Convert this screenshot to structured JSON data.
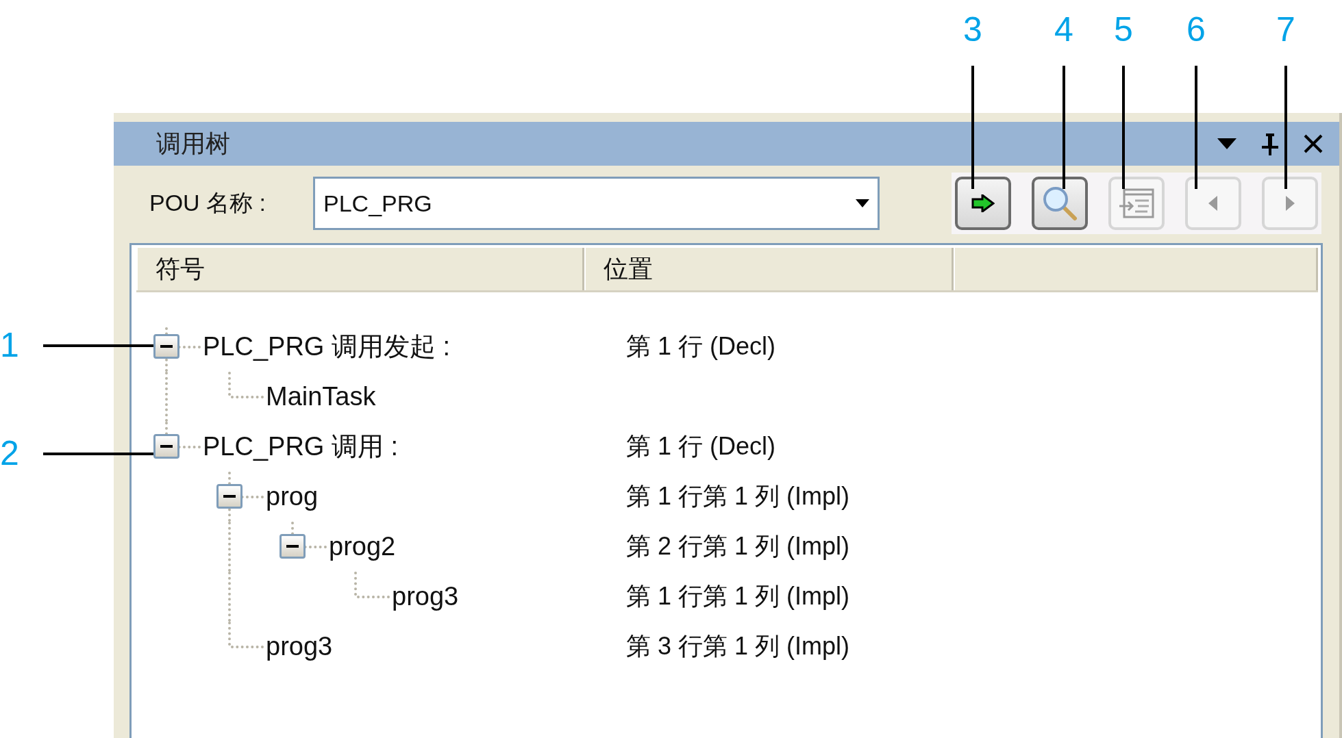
{
  "window": {
    "title": "调用树"
  },
  "pou": {
    "label": "POU 名称 :",
    "value": "PLC_PRG"
  },
  "toolbar": [
    {
      "kind": "goto",
      "disabled": false
    },
    {
      "kind": "search",
      "disabled": false
    },
    {
      "kind": "insert",
      "disabled": true
    },
    {
      "kind": "prev",
      "disabled": true
    },
    {
      "kind": "next",
      "disabled": true
    }
  ],
  "table": {
    "columns": [
      "符号",
      "位置"
    ],
    "rows": [
      {
        "symbol": "PLC_PRG 调用发起 :",
        "position": "第 1 行 (Decl)",
        "expanded": true,
        "children": [
          {
            "symbol": "MainTask"
          }
        ]
      },
      {
        "symbol": "PLC_PRG 调用 :",
        "position": "第 1 行 (Decl)",
        "expanded": true,
        "children": [
          {
            "symbol": "prog",
            "position": "第 1 行第 1 列 (Impl)",
            "expanded": true,
            "children": [
              {
                "symbol": "prog2",
                "position": "第 2 行第 1 列 (Impl)",
                "expanded": true,
                "children": [
                  {
                    "symbol": "prog3",
                    "position": "第 1 行第 1 列 (Impl)"
                  }
                ]
              }
            ]
          },
          {
            "symbol": "prog3",
            "position": "第 3 行第 1 列 (Impl)"
          }
        ]
      }
    ]
  },
  "callouts": [
    {
      "label": "1"
    },
    {
      "label": "2"
    },
    {
      "label": "3"
    },
    {
      "label": "4"
    },
    {
      "label": "5"
    },
    {
      "label": "6"
    },
    {
      "label": "7"
    }
  ]
}
